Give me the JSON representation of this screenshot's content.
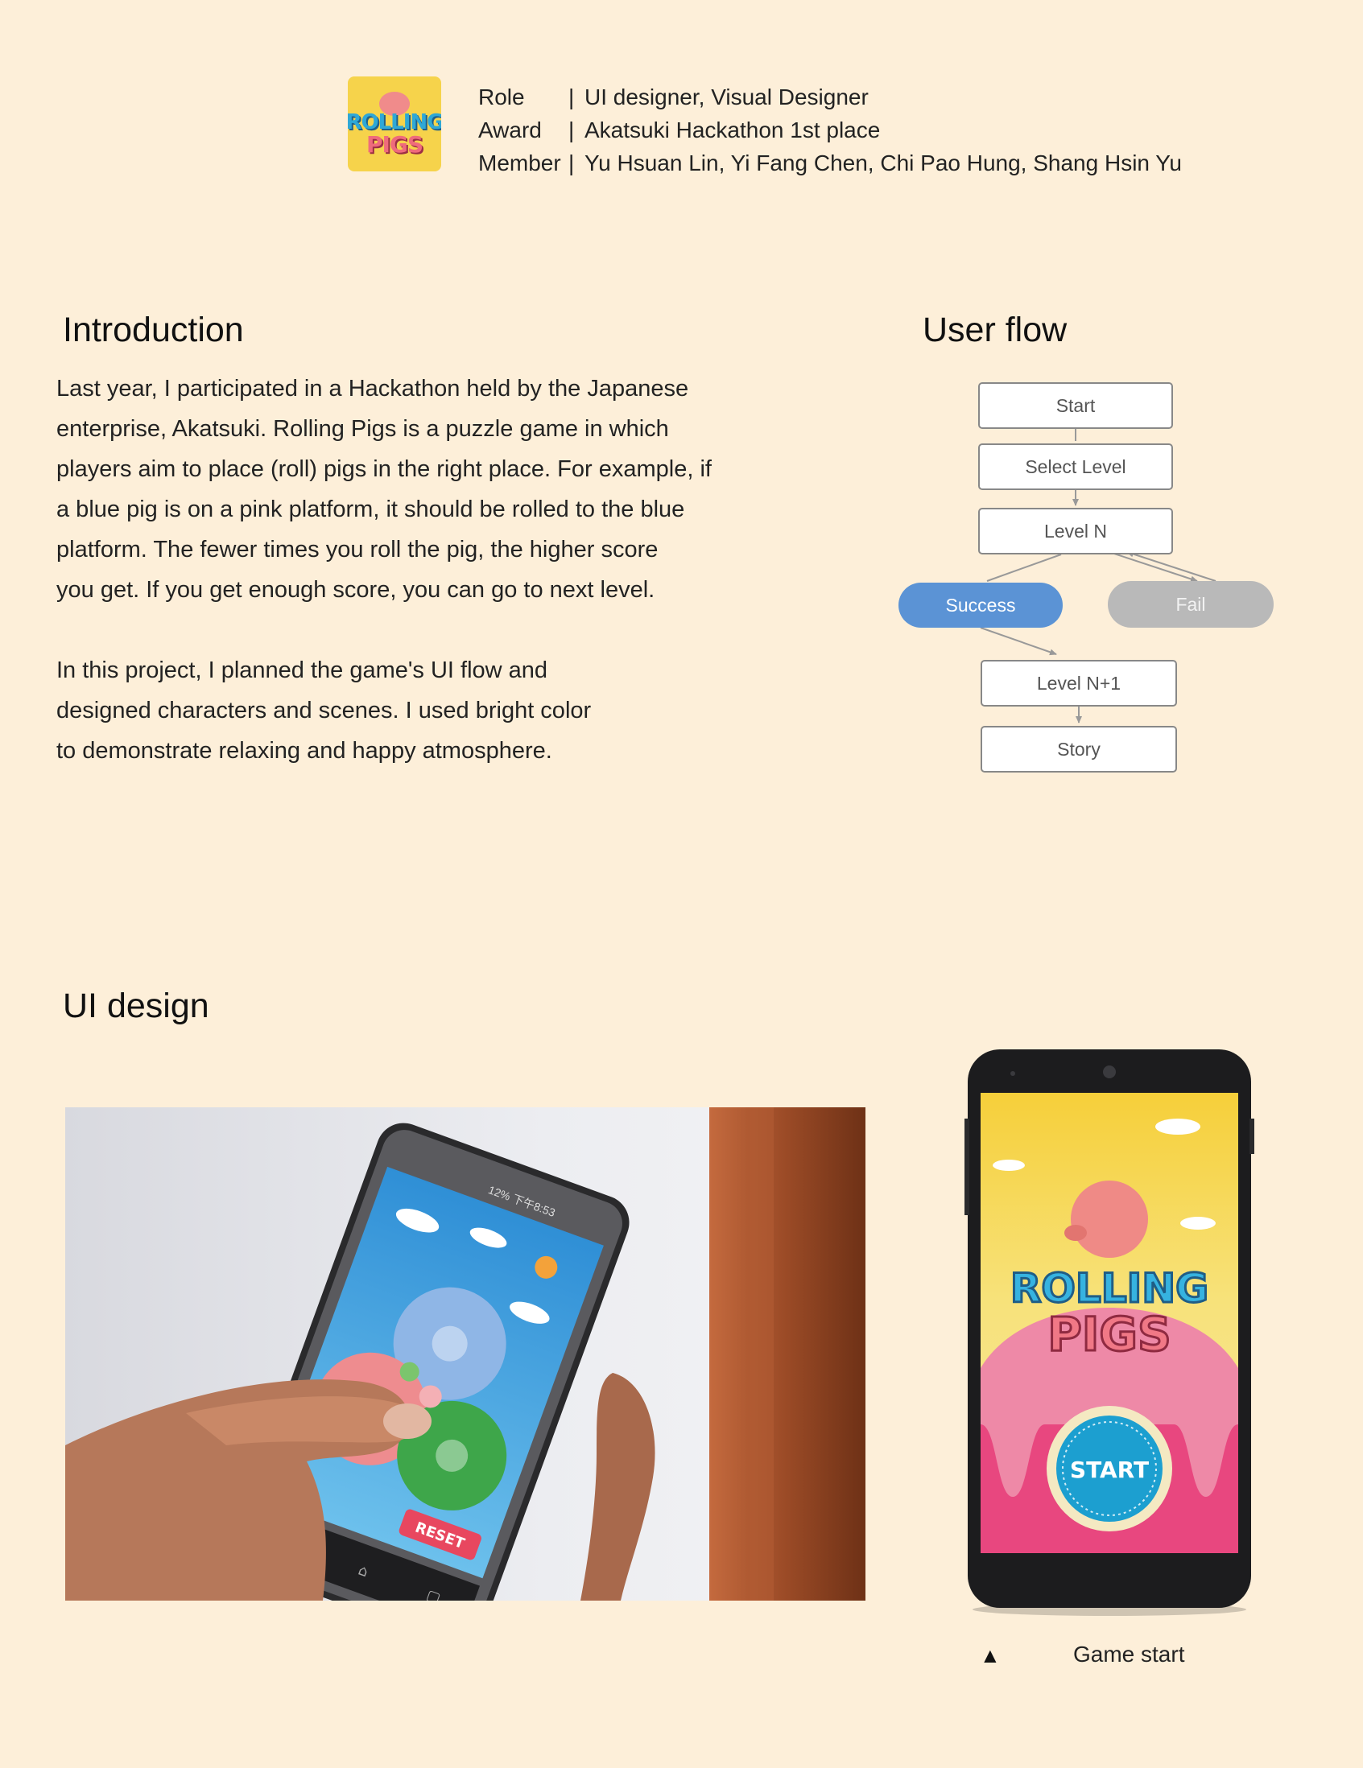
{
  "header": {
    "logo": {
      "line1": "ROLLING",
      "line2": "PIGS"
    },
    "meta": [
      {
        "label": "Role",
        "sep": "|",
        "value": "UI designer, Visual Designer"
      },
      {
        "label": "Award",
        "sep": "|",
        "value": "Akatsuki Hackathon 1st place"
      },
      {
        "label": "Member",
        "sep": "|",
        "value": "Yu Hsuan Lin, Yi Fang Chen, Chi Pao Hung, Shang Hsin Yu"
      }
    ]
  },
  "introduction": {
    "title": "Introduction",
    "paragraph1": [
      "Last year, I participated in a Hackathon held by the Japanese",
      "enterprise, Akatsuki. Rolling Pigs is a puzzle game in which",
      "players aim to place (roll) pigs in the right place. For example, if",
      "a blue pig is on a pink platform, it should be rolled to the blue",
      "platform. The fewer times you roll the pig, the higher score",
      "you get. If you get enough score, you can go to next level."
    ],
    "paragraph2": [
      "In this project, I planned the game's UI flow and",
      "designed characters and scenes. I used bright color",
      "to demonstrate relaxing and happy atmosphere."
    ]
  },
  "user_flow": {
    "title": "User flow",
    "nodes": {
      "start": "Start",
      "select_level": "Select Level",
      "level_n": "Level N",
      "success": "Success",
      "fail": "Fail",
      "level_n1": "Level N+1",
      "story": "Story"
    },
    "colors": {
      "success": "#5b93d5",
      "fail": "#b9b9b9",
      "border": "#888888",
      "arrow": "#999999"
    }
  },
  "ui_design": {
    "title": "UI design",
    "photo_phone": {
      "status": "12%  下午8:53",
      "reset_label": "RESET"
    },
    "mockup": {
      "logo_line1": "ROLLING",
      "logo_line2": "PIGS",
      "start_label": "START"
    },
    "caption_marker": "▲",
    "caption": "Game start"
  }
}
